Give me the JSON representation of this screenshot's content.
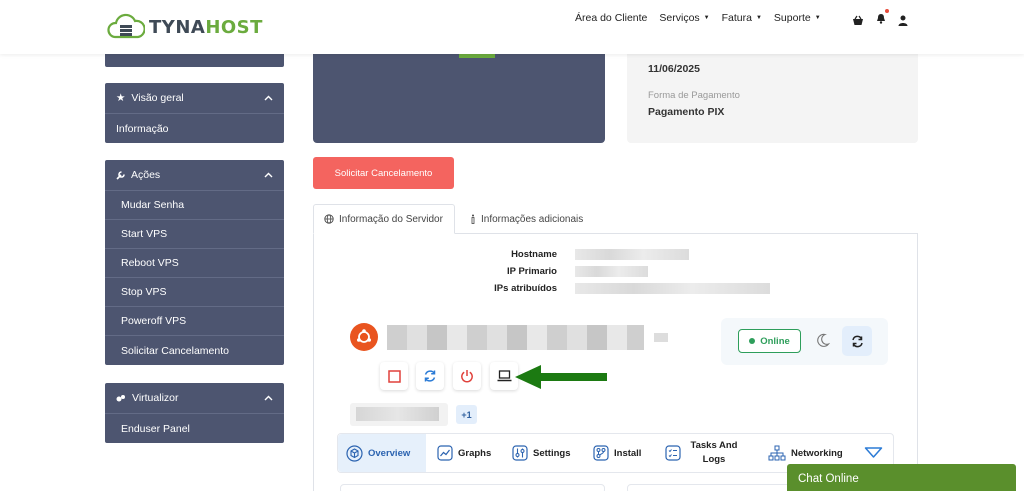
{
  "brand": {
    "part1": "TYNA",
    "part2": "HOST"
  },
  "nav": {
    "items": [
      {
        "label": "Área do Cliente",
        "dropdown": false
      },
      {
        "label": "Serviços",
        "dropdown": true
      },
      {
        "label": "Fatura",
        "dropdown": true
      },
      {
        "label": "Suporte",
        "dropdown": true
      }
    ],
    "icons": [
      "basket-icon",
      "bell-icon",
      "user-icon"
    ]
  },
  "sidebar": {
    "overview": {
      "title": "Visão geral",
      "items": [
        {
          "label": "Informação"
        }
      ]
    },
    "actions": {
      "title": "Ações",
      "items": [
        {
          "label": "Mudar Senha"
        },
        {
          "label": "Start VPS"
        },
        {
          "label": "Reboot VPS"
        },
        {
          "label": "Stop VPS"
        },
        {
          "label": "Poweroff VPS"
        },
        {
          "label": "Solicitar Cancelamento"
        }
      ]
    },
    "virtualizor": {
      "title": "Virtualizor",
      "items": [
        {
          "label": "Enduser Panel"
        }
      ]
    }
  },
  "billing": {
    "next_due_value": "11/06/2025",
    "payment_label": "Forma de Pagamento",
    "payment_value": "Pagamento PIX"
  },
  "cancel_button": "Solicitar Cancelamento",
  "tabs": {
    "server_info": "Informação do Servidor",
    "additional": "Informações adicionais"
  },
  "server": {
    "hostname_label": "Hostname",
    "primary_ip_label": "IP Primario",
    "assigned_ips_label": "IPs atribuídos",
    "status": "Online",
    "extra_ips": "+1"
  },
  "panel_tabs": [
    {
      "label": "Overview",
      "icon": "cube-icon"
    },
    {
      "label": "Graphs",
      "icon": "chart-icon"
    },
    {
      "label": "Settings",
      "icon": "sliders-icon"
    },
    {
      "label": "Install",
      "icon": "install-icon"
    },
    {
      "label": "Tasks And Logs",
      "icon": "tasks-icon"
    },
    {
      "label": "Networking",
      "icon": "network-icon"
    }
  ],
  "chat": {
    "label": "Chat Online"
  },
  "colors": {
    "sidebar": "#4d5570",
    "brand_green": "#6bab3e",
    "cancel_red": "#f4645f",
    "online_green": "#2e9e5b",
    "chat_green": "#5a8f2c"
  }
}
